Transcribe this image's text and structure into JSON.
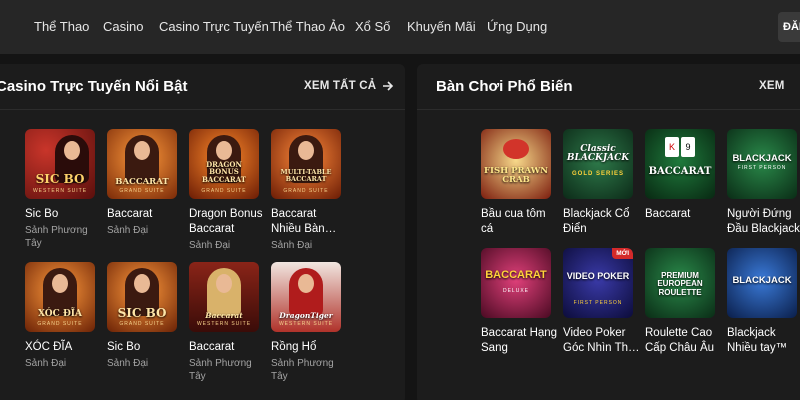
{
  "nav": {
    "items": [
      "Thể Thao",
      "Casino",
      "Casino Trực Tuyến",
      "Thể Thao Ảo",
      "Xổ Số",
      "Khuyến Mãi",
      "Ứng Dụng"
    ],
    "login_button": "ĐĂNG"
  },
  "live_casino": {
    "title": "Casino Trực Tuyến Nổi Bật",
    "see_all": "XEM TẤT CẢ",
    "games": [
      {
        "name": "Sic Bo",
        "provider": "Sảnh Phương Tây",
        "thumb_label": "SIC BO",
        "thumb_sub": "WESTERN SUITE"
      },
      {
        "name": "Baccarat",
        "provider": "Sảnh Đại",
        "thumb_label": "BACCARAT",
        "thumb_sub": "GRAND SUITE"
      },
      {
        "name": "Dragon Bonus Baccarat",
        "provider": "Sảnh Đại",
        "thumb_label": "DRAGON BONUS BACCARAT",
        "thumb_sub": "GRAND SUITE"
      },
      {
        "name": "Baccarat Nhiều Bàn…",
        "provider": "Sảnh Đại",
        "thumb_label": "MULTI-TABLE BACCARAT",
        "thumb_sub": "GRAND SUITE"
      },
      {
        "name": "XÓC ĐĨA",
        "provider": "Sảnh Đại",
        "thumb_label": "XÓC ĐĨA",
        "thumb_sub": "GRAND SUITE"
      },
      {
        "name": "Sic Bo",
        "provider": "Sảnh Đại",
        "thumb_label": "SIC BO",
        "thumb_sub": "GRAND SUITE"
      },
      {
        "name": "Baccarat",
        "provider": "Sảnh Phương Tây",
        "thumb_label": "Baccarat",
        "thumb_sub": "WESTERN SUITE"
      },
      {
        "name": "Rồng Hổ",
        "provider": "Sảnh Phương Tây",
        "thumb_label": "DragonTiger",
        "thumb_sub": "WESTERN SUITE"
      }
    ]
  },
  "table_games": {
    "title": "Bàn Chơi Phổ Biến",
    "see_all": "XEM",
    "new_badge": "MỚI",
    "games": [
      {
        "name": "Bầu cua tôm cá",
        "thumb_label": "FISH PRAWN CRAB"
      },
      {
        "name": "Blackjack Cổ Điển",
        "thumb_label": "Classic BLACKJACK",
        "thumb_sub": "GOLD SERIES"
      },
      {
        "name": "Baccarat",
        "thumb_label": "BACCARAT"
      },
      {
        "name": "Người Đứng Đầu Blackjack",
        "thumb_label": "BLACKJACK",
        "thumb_sub": "FIRST PERSON"
      },
      {
        "name": "Baccarat Hạng Sang",
        "thumb_label": "BACCARAT",
        "thumb_sub": "DELUXE"
      },
      {
        "name": "Video Poker Góc Nhìn Th…",
        "thumb_label": "VIDEO POKER",
        "thumb_sub": "FIRST PERSON"
      },
      {
        "name": "Roulette Cao Cấp Châu Âu",
        "thumb_label": "PREMIUM EUROPEAN ROULETTE"
      },
      {
        "name": "Blackjack Nhiều tay™",
        "thumb_label": "BLACKJACK"
      }
    ]
  }
}
